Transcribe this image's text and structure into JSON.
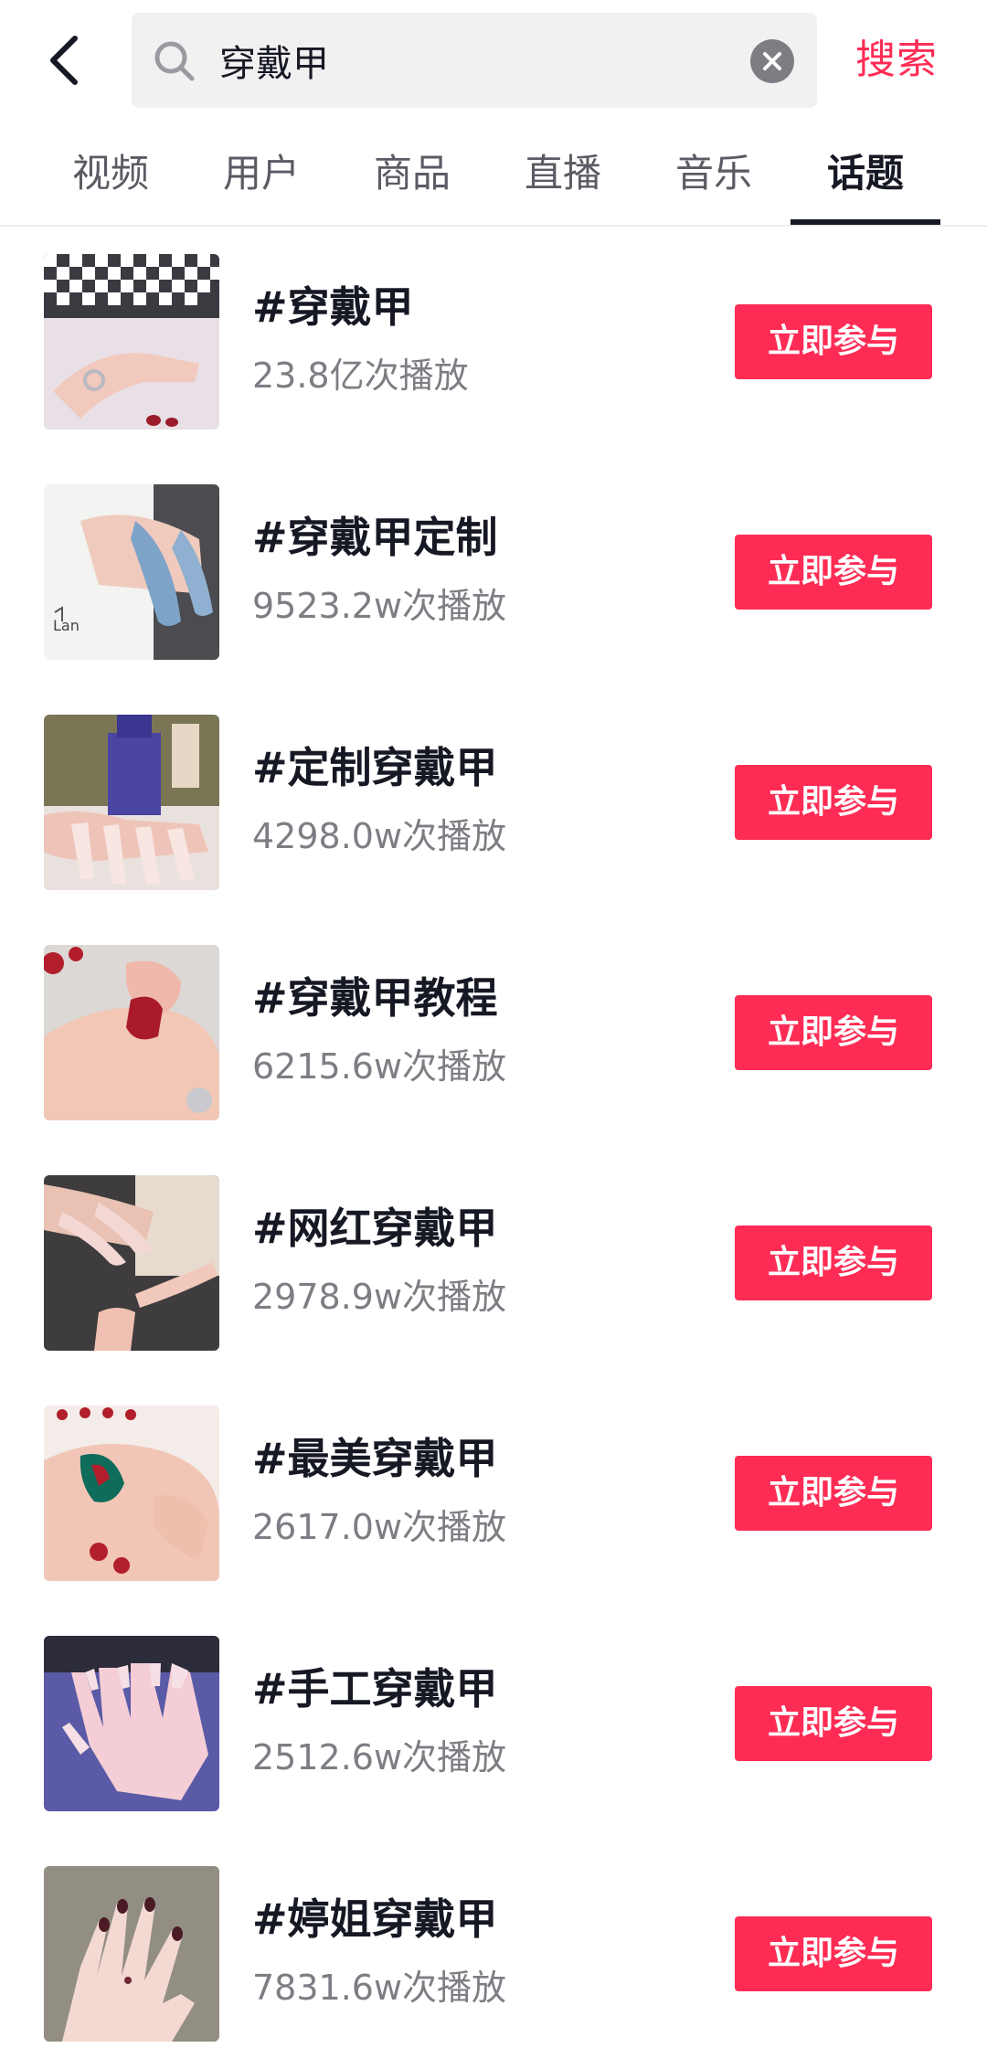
{
  "header": {
    "back_icon": "back-arrow-icon",
    "search_icon": "search-icon",
    "search_value": "穿戴甲",
    "clear_icon": "clear-icon",
    "search_button_label": "搜索",
    "accent_color": "#fe2c55"
  },
  "tabs": [
    {
      "label": "视频",
      "active": false
    },
    {
      "label": "用户",
      "active": false
    },
    {
      "label": "商品",
      "active": false
    },
    {
      "label": "直播",
      "active": false
    },
    {
      "label": "音乐",
      "active": false
    },
    {
      "label": "话题",
      "active": true
    }
  ],
  "topics": [
    {
      "title": "#穿戴甲",
      "plays": "23.8亿次播放",
      "button": "立即参与"
    },
    {
      "title": "#穿戴甲定制",
      "plays": "9523.2w次播放",
      "button": "立即参与"
    },
    {
      "title": "#定制穿戴甲",
      "plays": "4298.0w次播放",
      "button": "立即参与"
    },
    {
      "title": "#穿戴甲教程",
      "plays": "6215.6w次播放",
      "button": "立即参与"
    },
    {
      "title": "#网红穿戴甲",
      "plays": "2978.9w次播放",
      "button": "立即参与"
    },
    {
      "title": "#最美穿戴甲",
      "plays": "2617.0w次播放",
      "button": "立即参与"
    },
    {
      "title": "#手工穿戴甲",
      "plays": "2512.6w次播放",
      "button": "立即参与"
    },
    {
      "title": "#婷姐穿戴甲",
      "plays": "7831.6w次播放",
      "button": "立即参与"
    }
  ]
}
